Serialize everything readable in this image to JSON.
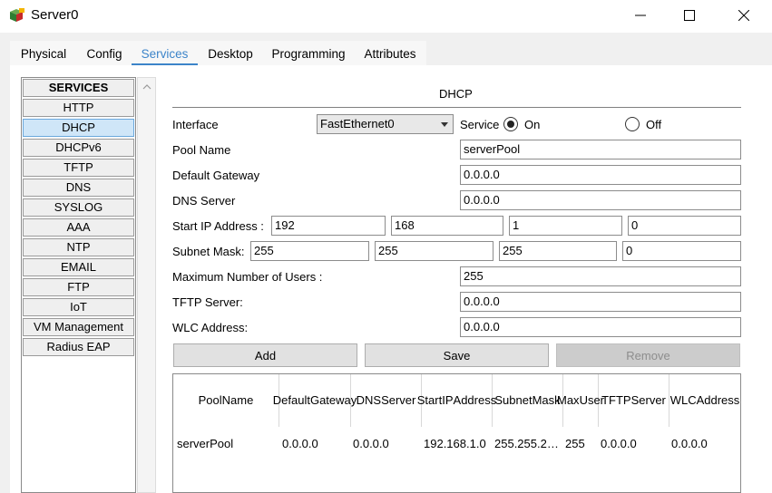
{
  "window": {
    "title": "Server0",
    "icon": "server-icon",
    "controls": [
      "minimize-icon",
      "maximize-icon",
      "close-icon"
    ]
  },
  "tabs": [
    {
      "label": "Physical",
      "active": false
    },
    {
      "label": "Config",
      "active": false
    },
    {
      "label": "Services",
      "active": true
    },
    {
      "label": "Desktop",
      "active": false
    },
    {
      "label": "Programming",
      "active": false
    },
    {
      "label": "Attributes",
      "active": false
    }
  ],
  "services": {
    "header": "SERVICES",
    "items": [
      "HTTP",
      "DHCP",
      "DHCPv6",
      "TFTP",
      "DNS",
      "SYSLOG",
      "AAA",
      "NTP",
      "EMAIL",
      "FTP",
      "IoT",
      "VM Management",
      "Radius EAP"
    ],
    "selected": "DHCP"
  },
  "dhcp": {
    "title": "DHCP",
    "interface_label": "Interface",
    "interface_value": "FastEthernet0",
    "service_label": "Service",
    "on_label": "On",
    "off_label": "Off",
    "service_state": "on",
    "pool_name_label": "Pool Name",
    "pool_name": "serverPool",
    "gateway_label": "Default Gateway",
    "gateway": "0.0.0.0",
    "dns_label": "DNS Server",
    "dns": "0.0.0.0",
    "start_ip_label": "Start IP Address :",
    "start_ip": [
      "192",
      "168",
      "1",
      "0"
    ],
    "subnet_label": "Subnet Mask:",
    "subnet": [
      "255",
      "255",
      "255",
      "0"
    ],
    "max_users_label": "Maximum Number of Users :",
    "max_users": "255",
    "tftp_label": "TFTP Server:",
    "tftp": "0.0.0.0",
    "wlc_label": "WLC Address:",
    "wlc": "0.0.0.0",
    "add_label": "Add",
    "save_label": "Save",
    "remove_label": "Remove"
  },
  "table": {
    "headers": [
      [
        "Pool",
        "Name"
      ],
      [
        "Default",
        "Gateway"
      ],
      [
        "DNS",
        "Server"
      ],
      [
        "Start",
        "IP",
        "Address"
      ],
      [
        "Subnet",
        "Mask"
      ],
      [
        "Max",
        "User"
      ],
      [
        "TFTP",
        "Server"
      ],
      [
        "WLC",
        "Address"
      ]
    ],
    "rows": [
      [
        "serverPool",
        "0.0.0.0",
        "0.0.0.0",
        "192.168.1.0",
        "255.255.2…",
        "255",
        "0.0.0.0",
        "0.0.0.0"
      ]
    ]
  }
}
